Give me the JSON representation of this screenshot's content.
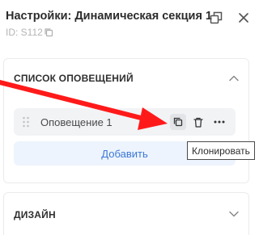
{
  "header": {
    "title": "Настройки: Динамическая секция 1",
    "id_label": "ID: S112"
  },
  "alerts_panel": {
    "title": "СПИСОК ОПОВЕЩЕНИЙ",
    "items": [
      {
        "label": "Оповещение 1"
      }
    ],
    "add_label": "Добавить"
  },
  "tooltip": {
    "text": "Клонировать"
  },
  "design_panel": {
    "title": "ДИЗАЙН"
  },
  "colors": {
    "accent": "#3d78d6",
    "add_bg": "#edf4fd",
    "item_bg": "#f2f3f5",
    "annotation_arrow": "#ff1a1a"
  },
  "icons": [
    "copy-icon",
    "popout-icon",
    "close-icon",
    "chevron-up-icon",
    "drag-handle-icon",
    "clone-icon",
    "trash-icon",
    "more-icon",
    "chevron-down-icon"
  ]
}
